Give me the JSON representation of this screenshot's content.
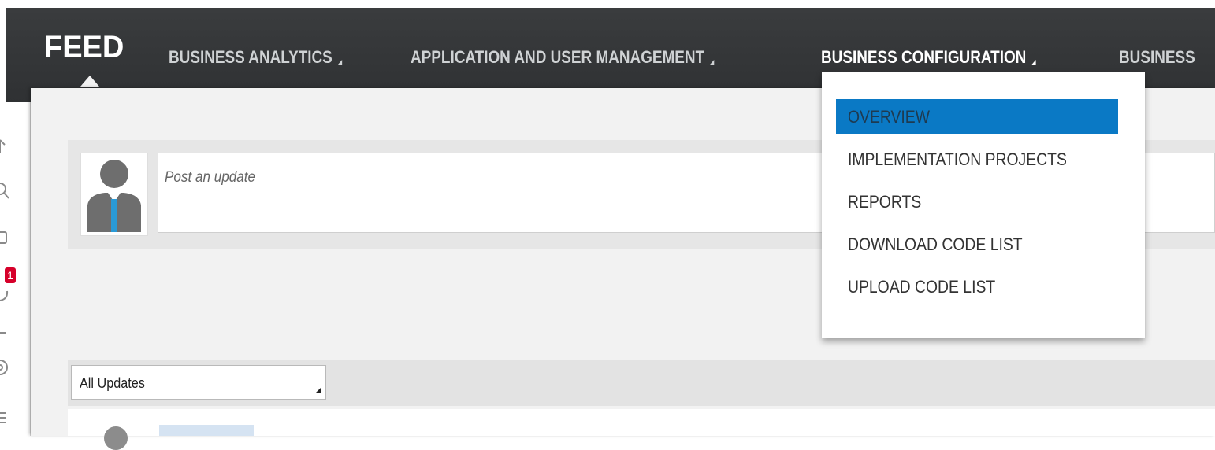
{
  "nav": {
    "feed_label": "FEED",
    "items": [
      {
        "label": "BUSINESS ANALYTICS"
      },
      {
        "label": "APPLICATION AND USER MANAGEMENT"
      },
      {
        "label": "BUSINESS CONFIGURATION"
      },
      {
        "label": "BUSINESS"
      }
    ]
  },
  "post": {
    "placeholder": "Post an update"
  },
  "filter": {
    "selected": "All Updates"
  },
  "sidebar": {
    "badge_count": "1"
  },
  "dropdown": {
    "items": [
      {
        "label": "OVERVIEW"
      },
      {
        "label": "IMPLEMENTATION PROJECTS"
      },
      {
        "label": "REPORTS"
      },
      {
        "label": "DOWNLOAD CODE LIST"
      },
      {
        "label": "UPLOAD CODE LIST"
      }
    ]
  },
  "colors": {
    "nav_bg": "#333537",
    "selected_item": "#0a79c5",
    "badge": "#d6002a",
    "avatar_tie": "#2a9ad6"
  },
  "icons": [
    "arrow-up-icon",
    "search-icon",
    "square-icon",
    "chat-icon",
    "dash-icon",
    "settings-icon",
    "menu-icon",
    "user-avatar-icon"
  ]
}
